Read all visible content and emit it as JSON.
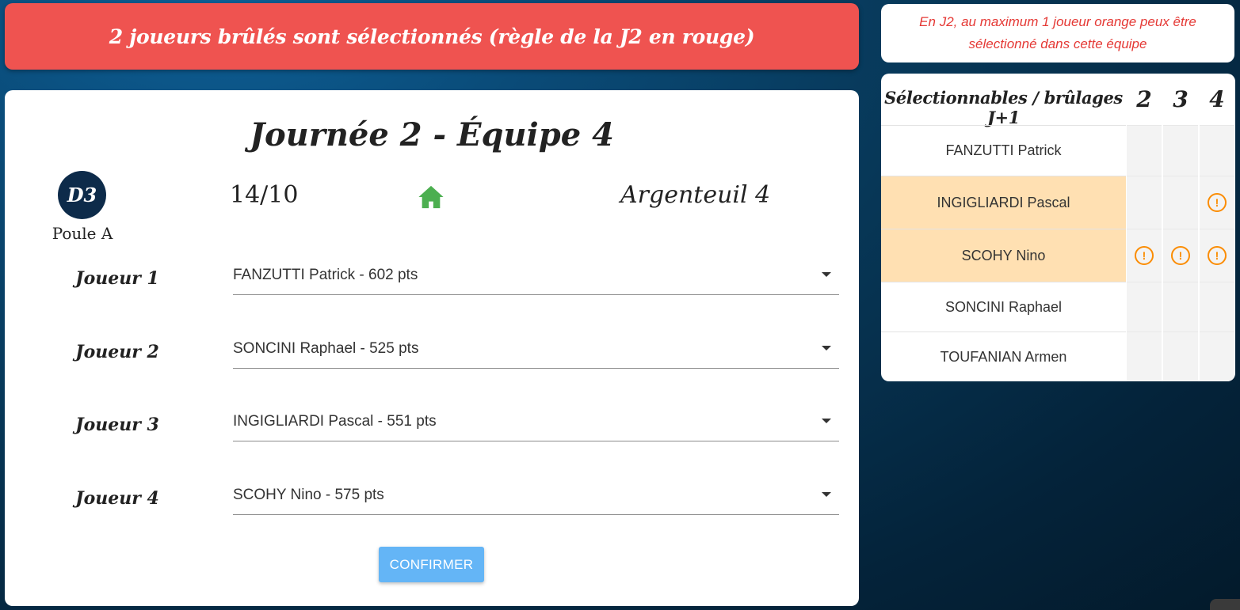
{
  "alert": {
    "message": "2 joueurs brûlés sont sélectionnés (règle de la J2 en rouge)",
    "color": "#ef5350"
  },
  "match": {
    "title": "Journée 2 - Équipe 4",
    "division": "D3",
    "poule": "Poule A",
    "date": "14/10",
    "venue_icon": "home-icon",
    "opponent": "Argenteuil 4"
  },
  "players": [
    {
      "label": "Joueur 1",
      "value": "FANZUTTI Patrick - 602 pts"
    },
    {
      "label": "Joueur 2",
      "value": "SONCINI Raphael - 525 pts"
    },
    {
      "label": "Joueur 3",
      "value": "INGIGLIARDI Pascal - 551 pts"
    },
    {
      "label": "Joueur 4",
      "value": "SCOHY Nino - 575 pts"
    }
  ],
  "confirm_label": "CONFIRMER",
  "info": {
    "message": "En J2, au maximum 1 joueur orange peux être sélectionné dans cette équipe"
  },
  "selectable_table": {
    "header": "Sélectionnables / brûlages J+1",
    "columns": [
      "2",
      "3",
      "4"
    ],
    "rows": [
      {
        "name": "FANZUTTI Patrick",
        "highlight": false,
        "warnings": [
          false,
          false,
          false
        ]
      },
      {
        "name": "INGIGLIARDI Pascal",
        "highlight": true,
        "warnings": [
          false,
          false,
          true
        ]
      },
      {
        "name": "SCOHY Nino",
        "highlight": true,
        "warnings": [
          true,
          true,
          true
        ]
      },
      {
        "name": "SONCINI Raphael",
        "highlight": false,
        "warnings": [
          false,
          false,
          false
        ]
      },
      {
        "name": "TOUFANIAN Armen",
        "highlight": false,
        "warnings": [
          false,
          false,
          false
        ]
      }
    ],
    "warning_icon": "alert-circle-icon",
    "highlight_color": "#ffe0b2",
    "warning_color": "#fb8c00"
  }
}
